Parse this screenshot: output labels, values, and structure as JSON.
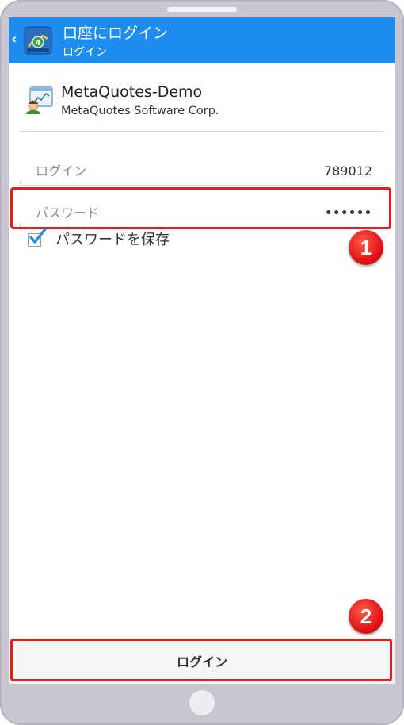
{
  "actionbar": {
    "back_icon": "chevron-left-icon",
    "app_icon": "metatrader-icon",
    "title": "口座にログイン",
    "subtitle": "ログイン",
    "background_color": "#1f8cf0"
  },
  "server": {
    "icon": "broker-server-icon",
    "name": "MetaQuotes-Demo",
    "company": "MetaQuotes Software Corp."
  },
  "form": {
    "login_label": "ログイン",
    "login_value": "789012",
    "password_label": "パスワード",
    "password_value": "••••••",
    "save_password_label": "パスワードを保存",
    "save_password_checked": true
  },
  "footer": {
    "login_button_label": "ログイン"
  },
  "annotations": {
    "badge_1": "1",
    "badge_2": "2",
    "highlight_color": "#e01f1f"
  }
}
